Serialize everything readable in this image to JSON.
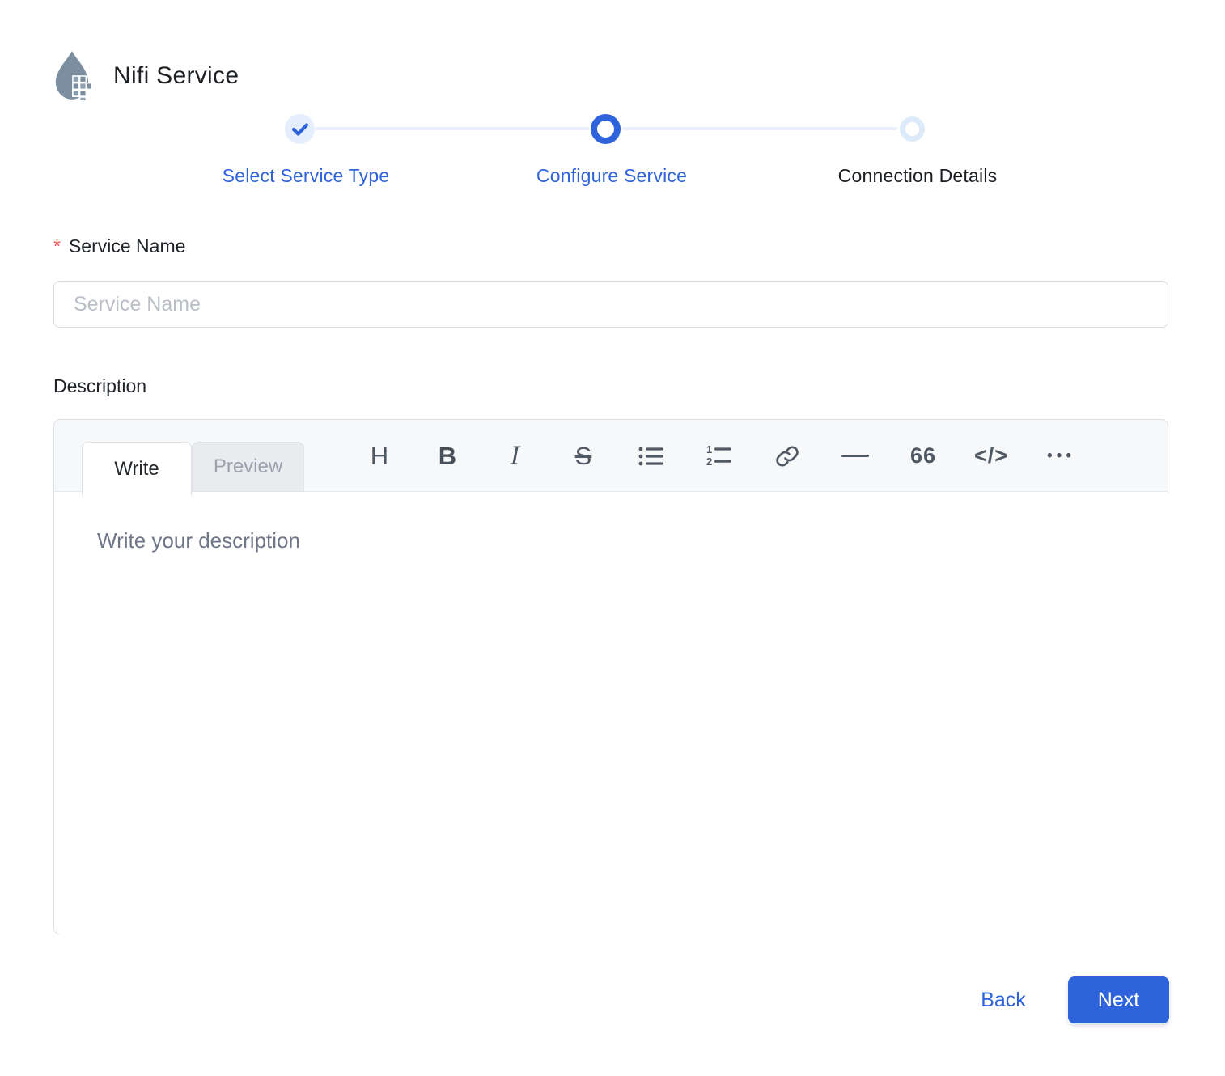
{
  "header": {
    "title": "Nifi Service",
    "icon": "nifi-drop-icon"
  },
  "stepper": {
    "steps": [
      {
        "label": "Select Service Type",
        "state": "completed"
      },
      {
        "label": "Configure Service",
        "state": "active"
      },
      {
        "label": "Connection Details",
        "state": "pending"
      }
    ]
  },
  "form": {
    "service_name": {
      "required_marker": "*",
      "label": "Service Name",
      "placeholder": "Service Name",
      "value": ""
    },
    "description": {
      "label": "Description",
      "placeholder": "Write your description",
      "value": ""
    }
  },
  "editor": {
    "tabs": [
      {
        "label": "Write",
        "active": true
      },
      {
        "label": "Preview",
        "active": false
      }
    ],
    "toolbar_icons": [
      "heading",
      "bold",
      "italic",
      "strikethrough",
      "unordered-list",
      "ordered-list",
      "link",
      "horizontal-rule",
      "quote",
      "code",
      "more"
    ],
    "glyphs": {
      "heading": "H",
      "bold": "B",
      "italic": "I",
      "strikethrough": "S",
      "quote": "66",
      "code": "</>",
      "more": "•••"
    }
  },
  "footer": {
    "back_label": "Back",
    "next_label": "Next"
  },
  "colors": {
    "accent_blue": "#2e63dc",
    "step_completed_bg": "#e4eefc",
    "step_pending_ring": "#ddeafa",
    "stepper_line": "#e7f0fc",
    "required_red": "#f04f4f",
    "toolbar_bg": "#f7f8fa",
    "editor_border": "#dcdfe4",
    "icon_gray": "#4f5863",
    "nifi_icon_slate": "#7b8fa0"
  }
}
